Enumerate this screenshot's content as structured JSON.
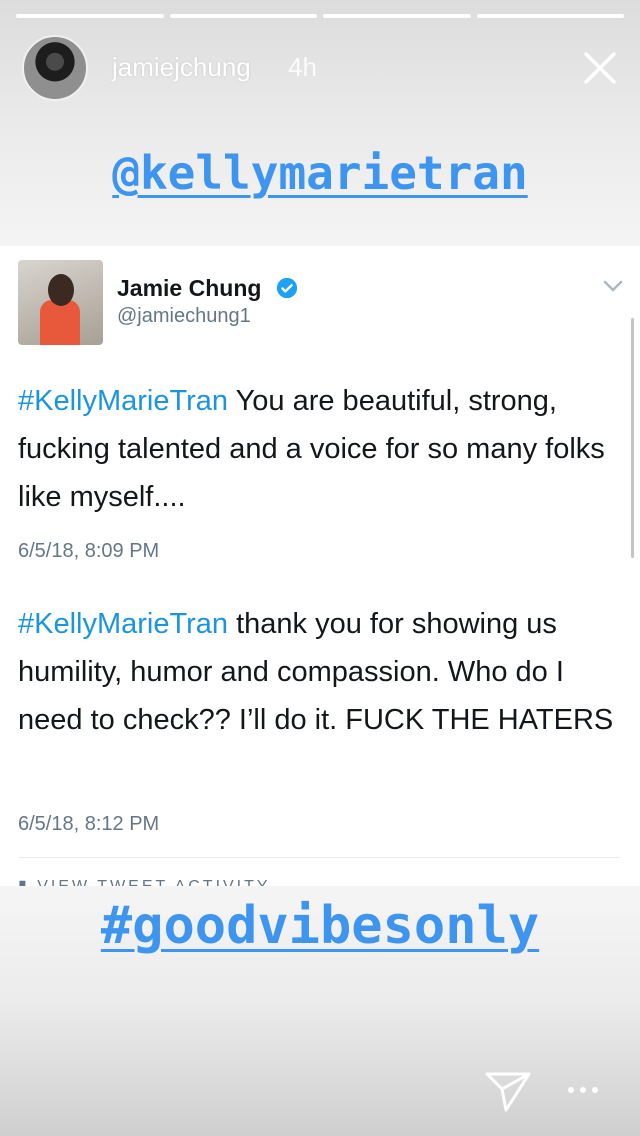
{
  "story": {
    "segments": 4,
    "username": "jamiejchung",
    "timestamp": "4h",
    "mention_sticker": "@kellymarietran",
    "hashtag_sticker": "#goodvibesonly",
    "icons": {
      "close": "close-icon",
      "send": "send-icon",
      "more": "more-icon"
    }
  },
  "tweet": {
    "display_name": "Jamie Chung",
    "handle": "@jamiechung1",
    "verified": true,
    "tweets": [
      {
        "hashtag": "#KellyMarieTran",
        "text": " You are beautiful, strong, fucking talented and a voice for so many folks like myself....",
        "date": "6/5/18, 8:09 PM"
      },
      {
        "hashtag": "#KellyMarieTran",
        "text": " thank you for showing us humility, humor and compassion. Who do I need to check?? I’ll do it. FUCK THE HATERS",
        "date": "6/5/18, 8:12 PM"
      }
    ],
    "activity_label": "VIEW TWEET ACTIVITY"
  },
  "colors": {
    "sticker_blue": "#3d95f0",
    "twitter_blue": "#1b95e0",
    "text_dark": "#14171a",
    "text_gray": "#657786"
  }
}
